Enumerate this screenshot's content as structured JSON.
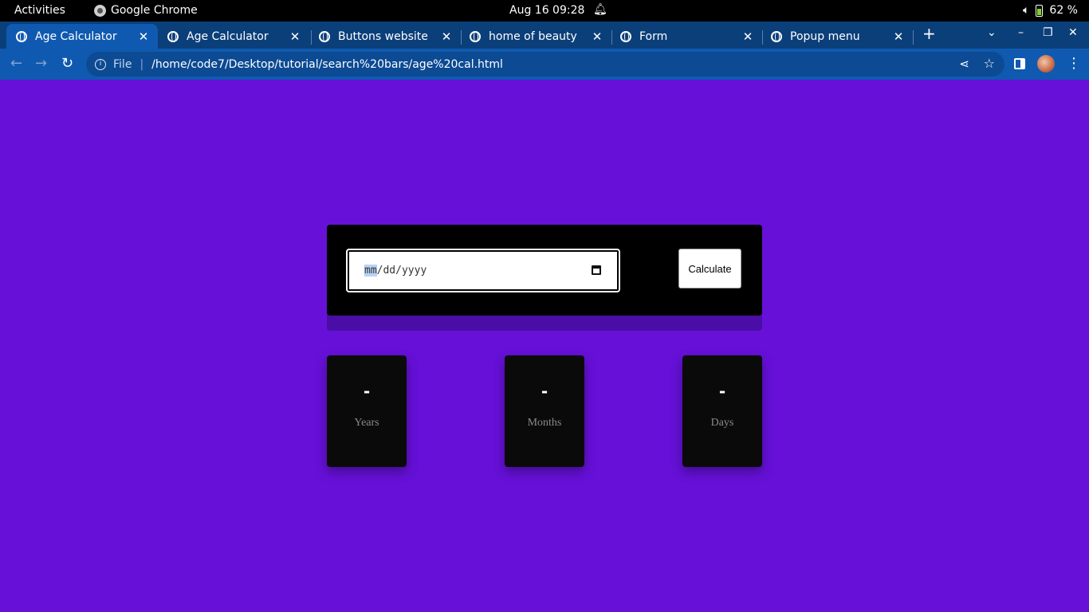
{
  "system_bar": {
    "activities": "Activities",
    "app_name": "Google Chrome",
    "clock": "Aug 16  09:28",
    "battery": "62 %"
  },
  "tabs": [
    {
      "title": "Age Calculator",
      "active": true
    },
    {
      "title": "Age Calculator",
      "active": false
    },
    {
      "title": "Buttons website",
      "active": false
    },
    {
      "title": "home of beauty",
      "active": false
    },
    {
      "title": "Form",
      "active": false
    },
    {
      "title": "Popup menu",
      "active": false
    }
  ],
  "toolbar": {
    "scheme": "File",
    "url": "/home/code7/Desktop/tutorial/search%20bars/age%20cal.html"
  },
  "calculator": {
    "date_placeholder_month": "mm",
    "date_placeholder_rest": "/dd/yyyy",
    "button_label": "Calculate"
  },
  "results": [
    {
      "value": "-",
      "label": "Years"
    },
    {
      "value": "-",
      "label": "Months"
    },
    {
      "value": "-",
      "label": "Days"
    }
  ],
  "colors": {
    "page_background": "#6610d8",
    "card_background": "#000000",
    "card_shadow": "#4a0ea6",
    "tab_strip": "#0b3f7a",
    "toolbar": "#0f5ab0"
  }
}
